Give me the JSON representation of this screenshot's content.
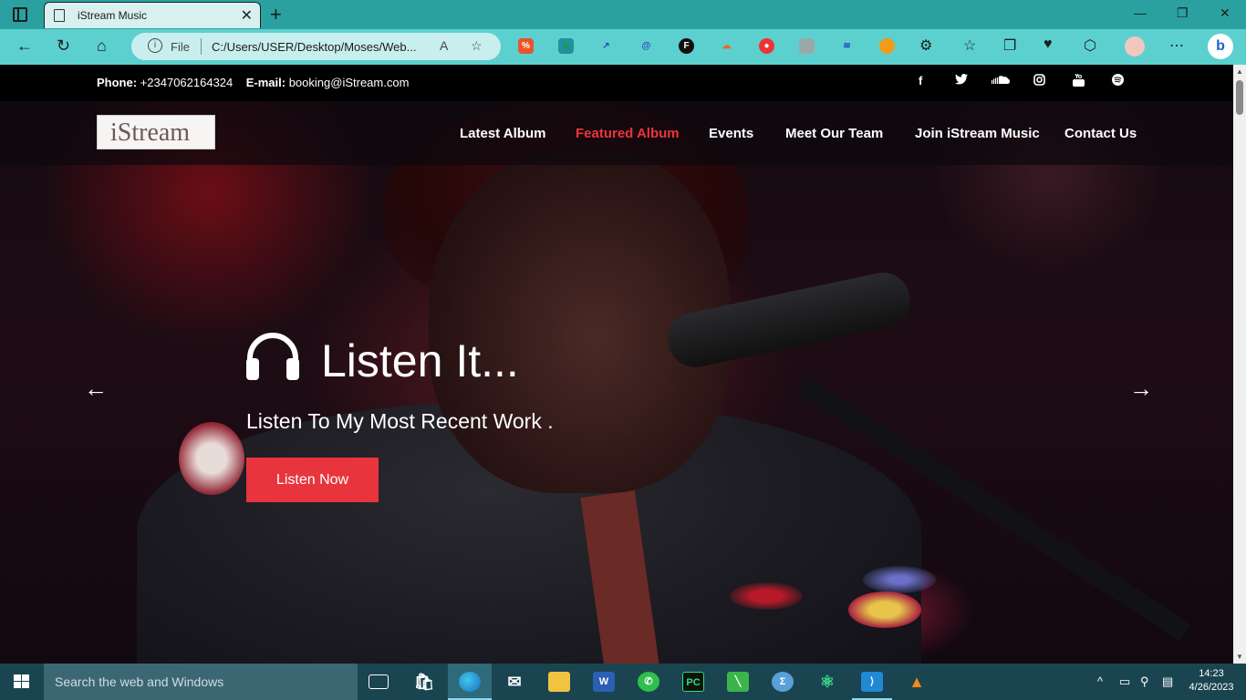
{
  "browser": {
    "tab_title": "iStream Music",
    "tab_close": "✕",
    "new_tab": "+",
    "window": {
      "minimize": "—",
      "maximize": "❐",
      "close": "✕"
    },
    "address": {
      "scheme_label": "File",
      "url": "C:/Users/USER/Desktop/Moses/Web..."
    }
  },
  "site": {
    "contact": {
      "phone_label": "Phone:",
      "phone": "+2347062164324",
      "email_label": "E-mail:",
      "email": "booking@iStream.com"
    },
    "social": [
      "facebook-icon",
      "twitter-icon",
      "soundcloud-icon",
      "instagram-icon",
      "youtube-icon",
      "spotify-icon"
    ],
    "logo": "iStream",
    "nav": [
      "Latest Album",
      "Featured Album",
      "Events",
      "Meet Our Team",
      "Join iStream Music",
      "Contact Us"
    ],
    "nav_active": "Featured Album",
    "hero": {
      "title": "Listen It...",
      "subtitle": "Listen To My Most Recent Work .",
      "cta": "Listen Now"
    },
    "accent_color": "#e8353d"
  },
  "taskbar": {
    "search_placeholder": "Search the web and Windows",
    "time": "14:23",
    "date": "4/26/2023"
  }
}
